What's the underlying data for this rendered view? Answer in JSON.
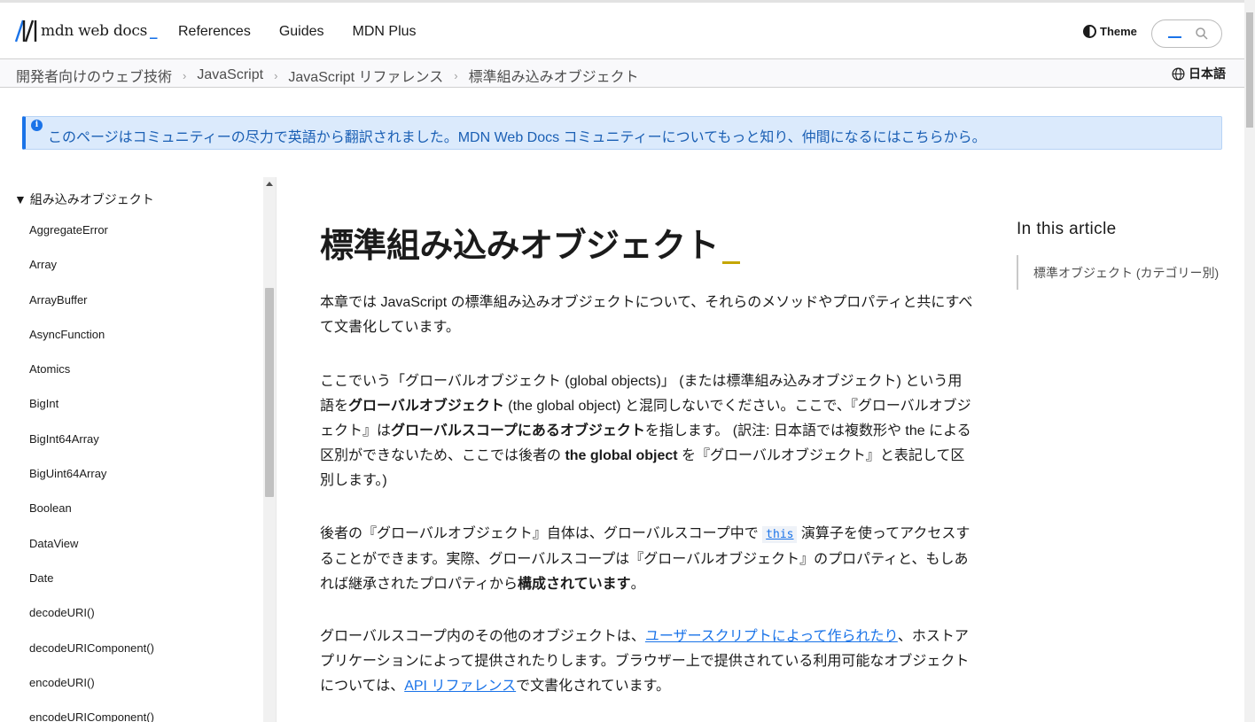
{
  "header": {
    "logo_text": "mdn web docs",
    "logo_suffix": "_",
    "nav": [
      "References",
      "Guides",
      "MDN Plus"
    ],
    "theme_label": "Theme"
  },
  "breadcrumb": {
    "items": [
      "開発者向けのウェブ技術",
      "JavaScript",
      "JavaScript リファレンス",
      "標準組み込みオブジェクト"
    ],
    "separator": "›",
    "language": "日本語"
  },
  "notice": {
    "text": "このページはコミュニティーの尽力で英語から翻訳されました。MDN Web Docs コミュニティーについてもっと知り、仲間になるにはこちらから。"
  },
  "sidebar": {
    "heading": "▼ 組み込みオブジェクト",
    "items": [
      "AggregateError",
      "Array",
      "ArrayBuffer",
      "AsyncFunction",
      "Atomics",
      "BigInt",
      "BigInt64Array",
      "BigUint64Array",
      "Boolean",
      "DataView",
      "Date",
      "decodeURI()",
      "decodeURIComponent()",
      "encodeURI()",
      "encodeURIComponent()"
    ]
  },
  "article": {
    "title": "標準組み込みオブジェクト",
    "p1": "本章では JavaScript の標準組み込みオブジェクトについて、それらのメソッドやプロパティと共にすべて文書化しています。",
    "p2_a": "ここでいう「グローバルオブジェクト (global objects)」 (または標準組み込みオブジェクト) という用語を",
    "p2_b1": "グローバルオブジェクト",
    "p2_c": " (the global object) と混同しないでください。ここで、『グローバルオブジェクト』は",
    "p2_b2": "グローバルスコープにあるオブジェクト",
    "p2_d": "を指します。 (訳注: 日本語では複数形や the による区別ができないため、ここでは後者の ",
    "p2_b3": "the global object",
    "p2_e": " を『グローバルオブジェクト』と表記して区別します。)",
    "p3_a": "後者の『グローバルオブジェクト』自体は、グローバルスコープ中で ",
    "p3_code": "this",
    "p3_b": " 演算子を使ってアクセスすることができます。実際、グローバルスコープは『グローバルオブジェクト』のプロパティと、もしあれば継承されたプロパティから",
    "p3_bold": "構成されています",
    "p3_c": "。",
    "p4_a": "グローバルスコープ内のその他のオブジェクトは、",
    "p4_link1": "ユーザースクリプトによって作られたり",
    "p4_b": "、ホストアプリケーションによって提供されたりします。ブラウザー上で提供されている利用可能なオブジェクトについては、",
    "p4_link2": "API リファレンス",
    "p4_c": "で文書化されています。"
  },
  "toc": {
    "title": "In this article",
    "items": [
      "標準オブジェクト (カテゴリー別)"
    ]
  },
  "colors": {
    "accent": "#1a73e8",
    "notice_bg": "#dbeafc",
    "title_cursor": "#c5a600"
  }
}
